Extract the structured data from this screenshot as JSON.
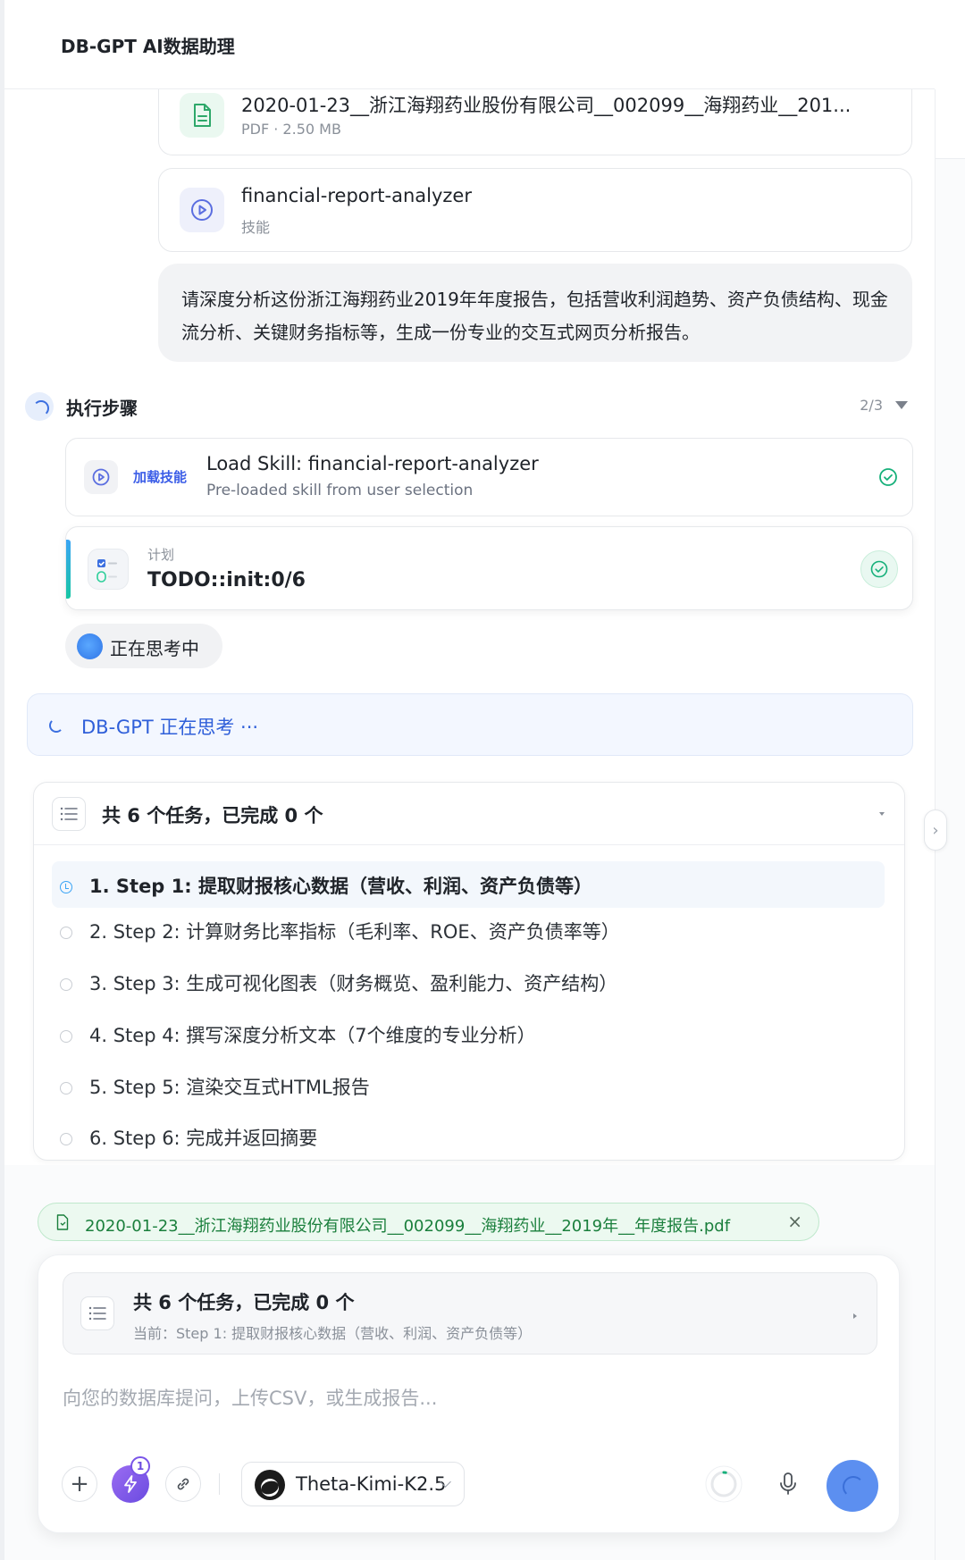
{
  "header": {
    "title": "DB-GPT AI数据助理"
  },
  "file_card": {
    "name": "2020-01-23__浙江海翔药业股份有限公司__002099__海翔药业__201...",
    "meta": "PDF · 2.50 MB",
    "icon": "document-icon"
  },
  "skill_card": {
    "name": "financial-report-analyzer",
    "meta": "技能",
    "icon": "play-icon"
  },
  "user_message": "请深度分析这份浙江海翔药业2019年年度报告，包括营收利润趋势、资产负债结构、现金流分析、关键财务指标等，生成一份专业的交互式网页分析报告。",
  "execution": {
    "title": "执行步骤",
    "count": "2/3",
    "steps": [
      {
        "tag": "加载技能",
        "title": "Load Skill: financial-report-analyzer",
        "subtitle": "Pre-loaded skill from user selection",
        "status": "done"
      },
      {
        "label": "计划",
        "title": "TODO::init:0/6",
        "status": "done"
      }
    ],
    "thinking_label": "正在思考中"
  },
  "thinking_banner": "DB-GPT 正在思考 ···",
  "todo": {
    "title": "共 6 个任务，已完成 0 个",
    "items": [
      {
        "text": "1. Step 1: 提取财报核心数据（营收、利润、资产负债等）",
        "active": true
      },
      {
        "text": "2. Step 2: 计算财务比率指标（毛利率、ROE、资产负债率等）",
        "active": false
      },
      {
        "text": "3. Step 3: 生成可视化图表（财务概览、盈利能力、资产结构）",
        "active": false
      },
      {
        "text": "4. Step 4: 撰写深度分析文本（7个维度的专业分析）",
        "active": false
      },
      {
        "text": "5. Step 5: 渲染交互式HTML报告",
        "active": false
      },
      {
        "text": "6. Step 6: 完成并返回摘要",
        "active": false
      }
    ]
  },
  "attachment": {
    "name": "2020-01-23__浙江海翔药业股份有限公司__002099__海翔药业__2019年__年度报告.pdf",
    "close": "×"
  },
  "composer": {
    "summary_title": "共 6 个任务，已完成 0 个",
    "summary_current": "当前：Step 1: 提取财报核心数据（营收、利润、资产负债等）",
    "placeholder": "向您的数据库提问，上传CSV，或生成报告...",
    "plus": "+",
    "skill_badge": "1",
    "model_name": "Theta-Kimi-K2.5"
  },
  "colors": {
    "accent_blue": "#3b6fe0",
    "success_green": "#16b07a",
    "skill_purple": "#6a4be0",
    "attachment_green": "#1a7f3c"
  }
}
